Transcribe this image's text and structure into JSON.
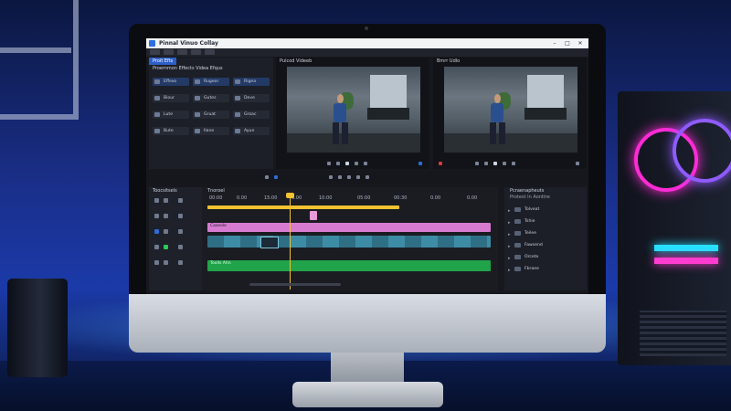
{
  "app": {
    "title": "Pinnal Vinuo Collay"
  },
  "window_controls": [
    "–",
    "□",
    "✕"
  ],
  "effects_panel": {
    "tab": "Proit Efts",
    "subtitle": "Proemmon Effects Videa Efqus",
    "buttons": [
      {
        "label": "Effexo",
        "icon": "effect-icon",
        "highlight": true
      },
      {
        "label": "Rugeor",
        "icon": "effect-icon",
        "highlight": true
      },
      {
        "label": "Rigea",
        "icon": "effect-icon",
        "highlight": true
      },
      {
        "label": "Biour",
        "icon": "effect-icon",
        "highlight": false
      },
      {
        "label": "Gutes",
        "icon": "effect-icon",
        "highlight": false
      },
      {
        "label": "Deve",
        "icon": "effect-icon",
        "highlight": false
      },
      {
        "label": "Lute",
        "icon": "effect-icon",
        "highlight": false
      },
      {
        "label": "Gruat",
        "icon": "effect-icon",
        "highlight": false
      },
      {
        "label": "Groac",
        "icon": "effect-icon",
        "highlight": false
      },
      {
        "label": "Bute",
        "icon": "effect-icon",
        "highlight": false
      },
      {
        "label": "Ilane",
        "icon": "effect-icon",
        "highlight": false
      },
      {
        "label": "Ayue",
        "icon": "effect-icon",
        "highlight": false
      }
    ]
  },
  "source_viewer": {
    "label": "Pulcod Videeb"
  },
  "program_viewer": {
    "label": "Bmrr Udlo"
  },
  "timeline": {
    "tab": "Tnoroel",
    "side_tab": "Toocsitsels",
    "ruler_ticks": [
      "00:00",
      "0.00",
      "15:00",
      "0.00",
      "10:00",
      "05:00",
      "00:30",
      "0.00",
      "0.00"
    ],
    "clips": [
      {
        "name": "tl-clip-title",
        "label": "",
        "track": 0,
        "color": "#f2c230"
      },
      {
        "name": "tl-clip-pink",
        "label": "Caasole",
        "track": 1,
        "color": "#d77bd0"
      },
      {
        "name": "tl-clip-video",
        "label": "",
        "track": 2,
        "color": "#2f8aa0"
      },
      {
        "name": "tl-clip-audio",
        "label": "Toolls Ahn",
        "track": 3,
        "color": "#21a34a"
      }
    ]
  },
  "project_panel": {
    "title": "Pcraenapheuts",
    "subtitle": "Protest In Aonttre",
    "items": [
      "Tolveat",
      "Tshie",
      "Teilee",
      "Fawsend",
      "Orcete",
      "Fbraee"
    ]
  }
}
